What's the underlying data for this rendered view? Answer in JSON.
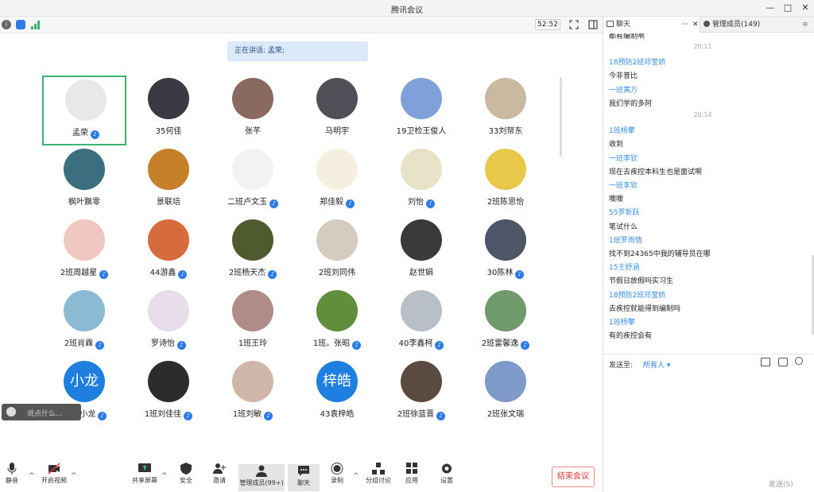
{
  "window": {
    "title": "腾讯会议"
  },
  "toolbar": {
    "timer": "52:52"
  },
  "main": {
    "speaking": "正在讲话: 孟荣;",
    "chat_placeholder": "说点什么..."
  },
  "participants": [
    {
      "name": "孟荣",
      "mic": "on",
      "active": true,
      "color": "#e8e8e8"
    },
    {
      "name": "35何佳",
      "mic": "none",
      "color": "#3a3a45"
    },
    {
      "name": "张芊",
      "mic": "none",
      "color": "#8a6a60"
    },
    {
      "name": "马明宇",
      "mic": "none",
      "color": "#505058"
    },
    {
      "name": "19卫检王俊人",
      "mic": "none",
      "color": "#7fa0d8"
    },
    {
      "name": "33刘帑东",
      "mic": "none",
      "color": "#c9b9a0"
    },
    {
      "name": "枫叶飘零",
      "mic": "none",
      "color": "#3b6f7f"
    },
    {
      "name": "景联培",
      "mic": "none",
      "color": "#c7802a"
    },
    {
      "name": "二班卢文玉",
      "mic": "on",
      "color": "#f2f2f2"
    },
    {
      "name": "郑佳毅",
      "mic": "on",
      "color": "#f5efe0"
    },
    {
      "name": "刘怡",
      "mic": "on",
      "color": "#e8e2c8"
    },
    {
      "name": "2班陈思怡",
      "mic": "none",
      "color": "#e9c748"
    },
    {
      "name": "2班周越星",
      "mic": "on",
      "color": "#f1c7c2"
    },
    {
      "name": "44游鑫",
      "mic": "on",
      "color": "#d66b3e"
    },
    {
      "name": "2班杨天杰",
      "mic": "on",
      "color": "#4f5a2f"
    },
    {
      "name": "2班刘同伟",
      "mic": "none",
      "color": "#d6cbc0"
    },
    {
      "name": "赵世娟",
      "mic": "none",
      "color": "#3c3a38"
    },
    {
      "name": "30陈林",
      "mic": "on",
      "color": "#4d5566"
    },
    {
      "name": "2班肖霖",
      "mic": "on",
      "color": "#8bbbd3"
    },
    {
      "name": "罗诗怡",
      "mic": "on",
      "color": "#e8ddea"
    },
    {
      "name": "1班王玲",
      "mic": "none",
      "color": "#b08c88"
    },
    {
      "name": "1班。张昭",
      "mic": "on",
      "color": "#5f8f3a"
    },
    {
      "name": "40李鑫柯",
      "mic": "on",
      "color": "#b9bfc6"
    },
    {
      "name": "2班雷馨逸",
      "mic": "on",
      "color": "#6f9a6a"
    },
    {
      "name": "37李小龙",
      "mic": "on",
      "color": "#1e7fe0",
      "text": "小龙"
    },
    {
      "name": "1班刘佳佳",
      "mic": "on",
      "color": "#2c2c2c"
    },
    {
      "name": "1班刘敏",
      "mic": "on",
      "color": "#cfb6a8"
    },
    {
      "name": "43袁梓皓",
      "mic": "none",
      "color": "#1e7fe0",
      "text": "梓皓"
    },
    {
      "name": "2班徐蓝晋",
      "mic": "on",
      "color": "#5a4a40"
    },
    {
      "name": "2班张文瑞",
      "mic": "none",
      "color": "#7d9ac9"
    }
  ],
  "bottombar": {
    "mute": "静音",
    "video": "开启视频",
    "share": "共享屏幕",
    "security": "安全",
    "invite": "邀请",
    "members": "管理成员(99+)",
    "chat": "聊天",
    "record": "录制",
    "breakout": "分组讨论",
    "apps": "应用",
    "settings": "设置",
    "end": "结束会议"
  },
  "side": {
    "tab_chat": "聊天",
    "tab_members": "管理成员(149)",
    "top_partial": "都有编制啊",
    "messages": [
      {
        "kind": "time",
        "text": "20:11"
      },
      {
        "kind": "sender",
        "text": "18预防2班邓莹娇"
      },
      {
        "kind": "text",
        "text": "今非昔比"
      },
      {
        "kind": "sender",
        "text": "一班黄万"
      },
      {
        "kind": "text",
        "text": "我们学的多阿"
      },
      {
        "kind": "time",
        "text": "20:14"
      },
      {
        "kind": "sender",
        "text": "1班杨攀"
      },
      {
        "kind": "text",
        "text": "收到"
      },
      {
        "kind": "sender",
        "text": "一班李钦"
      },
      {
        "kind": "text",
        "text": "现在去疾控本科生也是面试啊"
      },
      {
        "kind": "sender",
        "text": "一班李钦"
      },
      {
        "kind": "text",
        "text": "噢噢"
      },
      {
        "kind": "sender",
        "text": "55罗新跃"
      },
      {
        "kind": "text",
        "text": "笔试什么"
      },
      {
        "kind": "sender",
        "text": "1班罗雨情"
      },
      {
        "kind": "text",
        "text": "找不到24365中我的辅导员在哪"
      },
      {
        "kind": "sender",
        "text": "15王妤涵"
      },
      {
        "kind": "text",
        "text": "节假日放假吗实习生"
      },
      {
        "kind": "sender",
        "text": "18预防2班邓莹娇"
      },
      {
        "kind": "text",
        "text": "去疾控就能得到编制吗"
      },
      {
        "kind": "sender",
        "text": "1班杨攀"
      },
      {
        "kind": "text",
        "text": "有的疾控会有"
      }
    ],
    "send_to_label": "发送至:",
    "send_to_value": "所有人",
    "send_button": "发送(S)"
  },
  "colors": {
    "accent": "#2d7be5",
    "active_border": "#3cb371",
    "end": "#dd3333"
  }
}
